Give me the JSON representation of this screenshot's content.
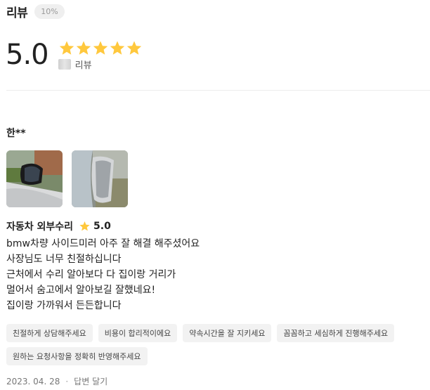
{
  "header": {
    "title": "리뷰",
    "badge": "10%"
  },
  "rating": {
    "score": "5.0",
    "stars": 5,
    "star_color": "#FFC83D",
    "count_label": "리뷰"
  },
  "review": {
    "reviewer": "한**",
    "photos": [
      "side-mirror-photo-1",
      "side-mirror-photo-2"
    ],
    "service": "자동차 외부수리",
    "service_score": "5.0",
    "lines": [
      "bmw차량 사이드미러 아주 잘 해결 해주셨어요",
      "사장님도 너무 친절하십니다",
      "근처에서 수리 알아보다 다 집이랑 거리가",
      "멀어서 숨고에서 알아보길 잘했네요!",
      "집이랑 가까워서 든든합니다"
    ],
    "tags": [
      "친절하게 상담해주세요",
      "비용이 합리적이에요",
      "약속시간을 잘 지키세요",
      "꼼꼼하고 세심하게 진행해주세요",
      "원하는 요청사항을 정확히 반영해주세요"
    ],
    "date": "2023. 04. 28",
    "separator": "·",
    "reply_label": "답변 달기"
  }
}
